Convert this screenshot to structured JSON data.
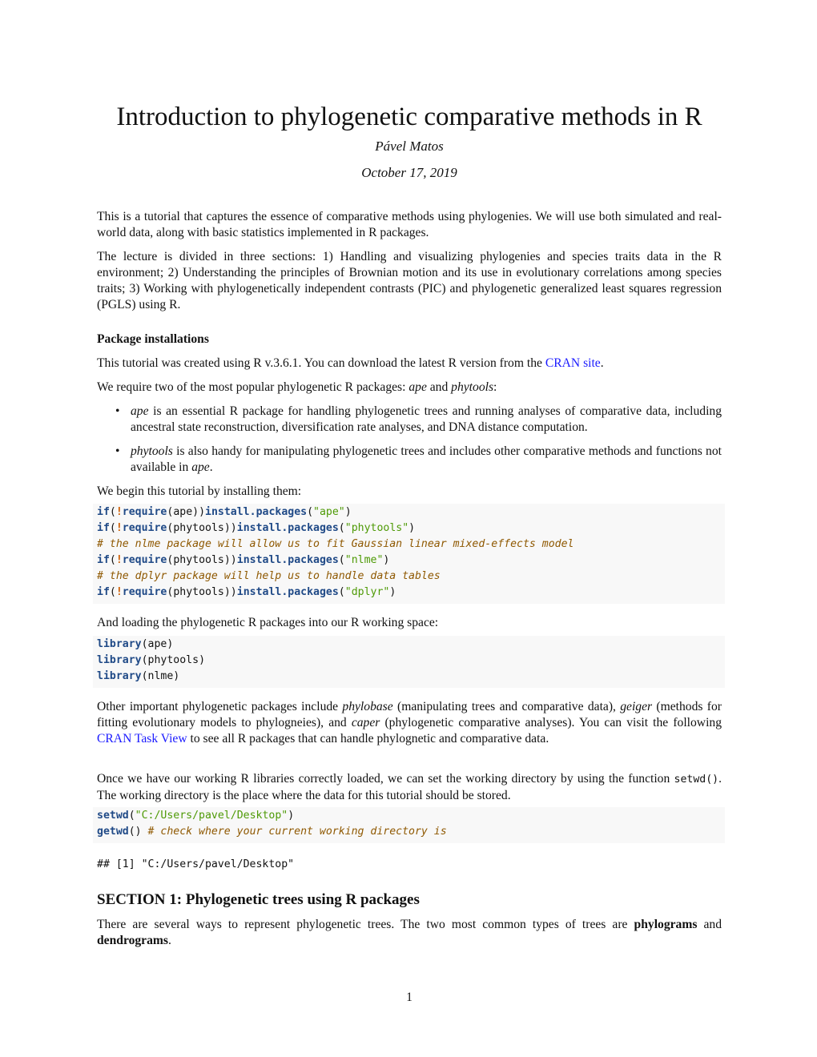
{
  "header": {
    "title": "Introduction to phylogenetic comparative methods in R",
    "author": "Pável Matos",
    "date": "October 17, 2019"
  },
  "intro": {
    "p1": "This is a tutorial that captures the essence of comparative methods using phylogenies. We will use both simulated and real-world data, along with basic statistics implemented in R packages.",
    "p2": "The lecture is divided in three sections: 1) Handling and visualizing phylogenies and species traits data in the R environment; 2) Understanding the principles of Brownian motion and its use in evolutionary correlations among species traits; 3) Working with phylogenetically independent contrasts (PIC) and phylogenetic generalized least squares regression (PGLS) using R."
  },
  "package_installations": {
    "heading": "Package installations",
    "p1_before": "This tutorial was created using R v.3.6.1. You can download the latest R version from the ",
    "p1_link": "CRAN site",
    "p1_after": ".",
    "p2_before": "We require two of the most popular phylogenetic R packages: ",
    "p2_pkg1": "ape",
    "p2_mid": " and ",
    "p2_pkg2": "phytools",
    "p2_after": ":",
    "bullets": [
      {
        "pkg": "ape",
        "text": " is an essential R package for handling phylogenetic trees and running analyses of comparative data, including ancestral state reconstruction, diversification rate analyses, and DNA distance computation."
      },
      {
        "pkg": "phytools",
        "text": " is also handy for manipulating phylogenetic trees and includes other comparative methods and functions not available in ",
        "pkg_end": "ape",
        "end": "."
      }
    ],
    "p3": "We begin this tutorial by installing them:",
    "install_code": {
      "if": "if",
      "not": "!",
      "require": "require",
      "install": "install.packages",
      "lines": [
        {
          "type": "install",
          "arg": "ape",
          "pkg": "\"ape\""
        },
        {
          "type": "install",
          "arg": "phytools",
          "pkg": "\"phytools\""
        },
        {
          "type": "comment",
          "text": "# the nlme package will allow us to fit Gaussian linear mixed-effects model"
        },
        {
          "type": "install",
          "arg": "phytools",
          "pkg": "\"nlme\""
        },
        {
          "type": "comment",
          "text": "# the dplyr package will help us to handle data tables"
        },
        {
          "type": "install",
          "arg": "phytools",
          "pkg": "\"dplyr\""
        }
      ]
    },
    "p4": "And loading the phylogenetic R packages into our R working space:",
    "library_code": {
      "fn": "library",
      "args": [
        "ape",
        "phytools",
        "nlme"
      ]
    },
    "p5": {
      "t1": "Other important phylogenetic packages include ",
      "pkg1": "phylobase",
      "t2": " (manipulating trees and comparative data), ",
      "pkg2": "geiger",
      "t3": " (methods for fitting evolutionary models to phylogneies), and ",
      "pkg3": "caper",
      "t4": " (phylogenetic comparative analyses). You can visit the following ",
      "link": "CRAN Task View",
      "t5": " to see all R packages that can handle phylognetic and comparative data."
    },
    "p6": {
      "t1": "Once we have our working R libraries correctly loaded, we can set the working directory by using the function ",
      "code": "setwd()",
      "t2": ". The working directory is the place where the data for this tutorial should be stored."
    },
    "wd_code": {
      "setwd": "setwd",
      "setwd_arg": "\"C:/Users/pavel/Desktop\"",
      "getwd": "getwd",
      "getwd_comment": "# check where your current working directory is"
    },
    "output": "## [1] \"C:/Users/pavel/Desktop\""
  },
  "section1": {
    "heading": "SECTION 1: Phylogenetic trees using R packages",
    "t1": "There are several ways to represent phylogenetic trees. The two most common types of trees are ",
    "b1": "phylograms",
    "t2": " and ",
    "b2": "dendrograms",
    "t3": "."
  },
  "footer": {
    "page_number": "1"
  }
}
